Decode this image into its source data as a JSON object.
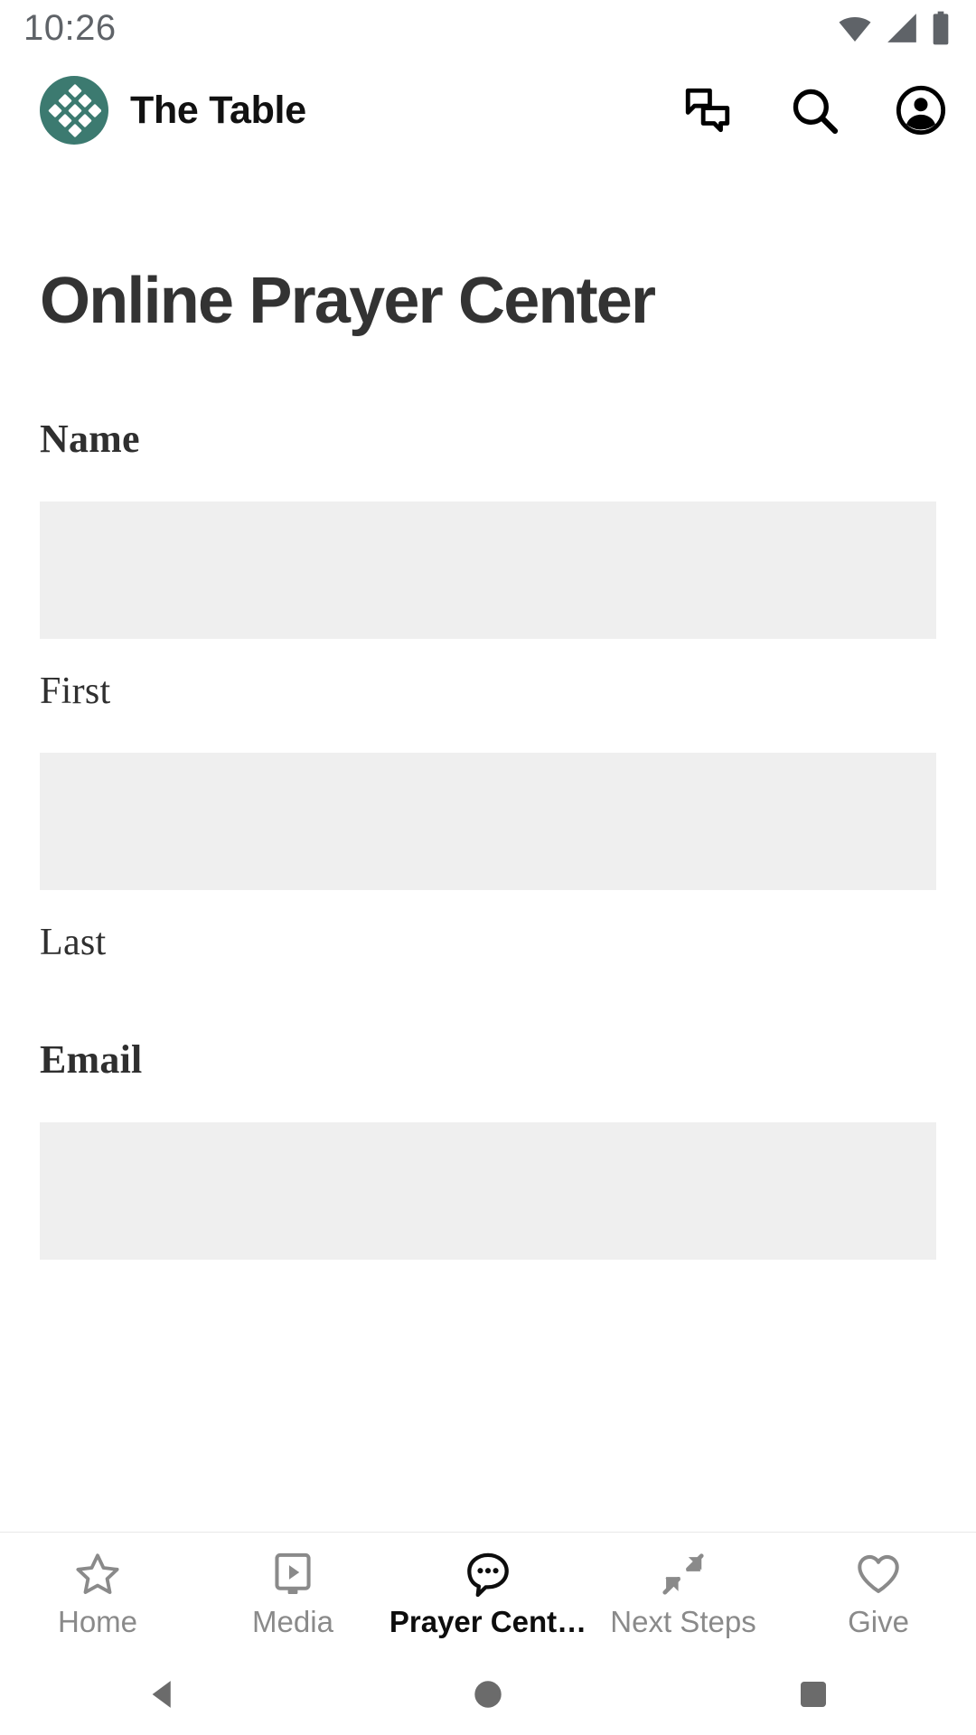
{
  "status_bar": {
    "time": "10:26",
    "icons": [
      "wifi-icon",
      "cell-signal-icon",
      "battery-icon"
    ],
    "icon_color": "#5f6368"
  },
  "header": {
    "logo_icon": "table-diamond-lattice-logo",
    "logo_color": "#3c7a70",
    "brand_name": "The Table",
    "actions": [
      {
        "icon": "chat-bubbles-icon",
        "label": "Messages"
      },
      {
        "icon": "search-icon",
        "label": "Search"
      },
      {
        "icon": "account-circle-icon",
        "label": "Account"
      }
    ],
    "action_color": "#000000"
  },
  "main": {
    "page_title": "Online Prayer Center",
    "fields": [
      {
        "label": "Name",
        "inputs": [
          {
            "value": "",
            "placeholder": "",
            "sub_label": "First"
          },
          {
            "value": "",
            "placeholder": "",
            "sub_label": "Last"
          }
        ]
      },
      {
        "label": "Email",
        "inputs": [
          {
            "value": "",
            "placeholder": "",
            "sub_label": ""
          }
        ]
      }
    ],
    "input_background": "#efefef",
    "title_color": "#333333"
  },
  "bottom_nav": {
    "items": [
      {
        "label": "Home",
        "icon": "star-outline-icon",
        "active": false
      },
      {
        "label": "Media",
        "icon": "media-player-icon",
        "active": false
      },
      {
        "label": "Prayer Cent…",
        "icon": "chat-dots-bubble-icon",
        "active": true
      },
      {
        "label": "Next Steps",
        "icon": "arrows-converge-icon",
        "active": false
      },
      {
        "label": "Give",
        "icon": "heart-outline-icon",
        "active": false
      }
    ],
    "inactive_color": "#8a8a8a",
    "active_color": "#0d0d0d"
  },
  "android_nav": {
    "buttons": [
      {
        "icon": "back-triangle-icon",
        "label": "Back"
      },
      {
        "icon": "home-circle-icon",
        "label": "Home"
      },
      {
        "icon": "recents-square-icon",
        "label": "Recents"
      }
    ],
    "color": "#6b6b6b"
  }
}
